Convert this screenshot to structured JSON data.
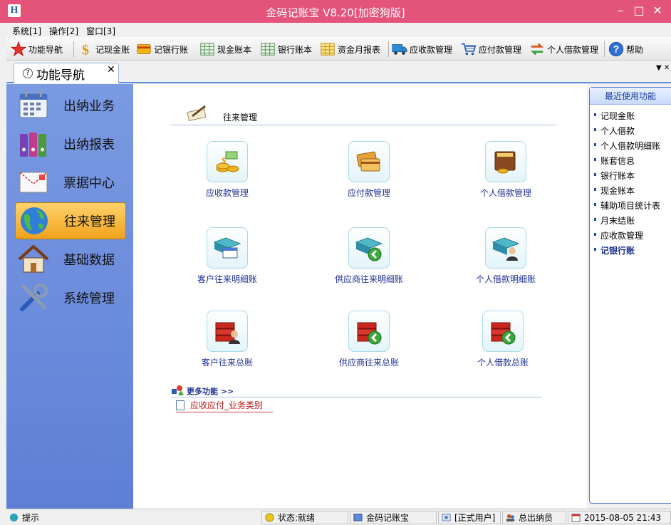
{
  "window": {
    "title": "金码记账宝 V8.20[加密狗版]",
    "min_glyph": "–",
    "max_glyph": "□",
    "close_glyph": "✕",
    "icon_glyph": "H"
  },
  "menu": [
    "系统[1]",
    "操作[2]",
    "窗口[3]"
  ],
  "toolbar": [
    {
      "label": "功能导航",
      "icon": "star-icon"
    },
    {
      "label": "记现金账",
      "icon": "dollar-icon"
    },
    {
      "label": "记银行账",
      "icon": "card-icon"
    },
    {
      "label": "现金账本",
      "icon": "grid-icon"
    },
    {
      "label": "银行账本",
      "icon": "grid-icon"
    },
    {
      "label": "资金月报表",
      "icon": "grid-yellow-icon"
    },
    {
      "label": "应收款管理",
      "icon": "truck-icon"
    },
    {
      "label": "应付款管理",
      "icon": "cart-icon"
    },
    {
      "label": "个人借款管理",
      "icon": "exchange-icon"
    },
    {
      "label": "帮助",
      "icon": "help-icon"
    }
  ],
  "tab": {
    "label": "功能导航",
    "help_glyph": "?",
    "close_glyph": "✕",
    "arrows": "▼ ✕"
  },
  "nav": [
    {
      "label": "出纳业务",
      "icon": "calendar-icon",
      "active": false
    },
    {
      "label": "出纳报表",
      "icon": "binders-icon",
      "active": false
    },
    {
      "label": "票据中心",
      "icon": "envelope-icon",
      "active": false
    },
    {
      "label": "往来管理",
      "icon": "globe-icon",
      "active": true
    },
    {
      "label": "基础数据",
      "icon": "house-icon",
      "active": false
    },
    {
      "label": "系统管理",
      "icon": "tools-icon",
      "active": false
    }
  ],
  "section": {
    "title": "往来管理"
  },
  "functions": [
    {
      "label": "应收款管理",
      "icon": "coins-icon"
    },
    {
      "label": "应付款管理",
      "icon": "cards-icon"
    },
    {
      "label": "个人借款管理",
      "icon": "wallet-icon"
    },
    {
      "label": "客户往来明细账",
      "icon": "ledger-open-icon"
    },
    {
      "label": "供应商往来明细账",
      "icon": "ledger-back-icon"
    },
    {
      "label": "个人借款明细账",
      "icon": "ledger-user-icon"
    },
    {
      "label": "客户往来总账",
      "icon": "books-user-icon"
    },
    {
      "label": "供应商往来总账",
      "icon": "books-back-icon"
    },
    {
      "label": "个人借款总账",
      "icon": "books-back-icon"
    }
  ],
  "more": {
    "title": "更多功能 >>",
    "links": [
      "应收应付_业务类别"
    ]
  },
  "recent": {
    "title": "最近使用功能",
    "items": [
      {
        "label": "记现金账",
        "bold": false
      },
      {
        "label": "个人借款",
        "bold": false
      },
      {
        "label": "个人借款明细账",
        "bold": false
      },
      {
        "label": "账套信息",
        "bold": false
      },
      {
        "label": "银行账本",
        "bold": false
      },
      {
        "label": "现金账本",
        "bold": false
      },
      {
        "label": "辅助项目统计表",
        "bold": false
      },
      {
        "label": "月末结账",
        "bold": false
      },
      {
        "label": "应收款管理",
        "bold": false
      },
      {
        "label": "记银行账",
        "bold": true
      }
    ]
  },
  "status": {
    "hint": "提示",
    "state": "状态:就绪",
    "app": "金码记账宝",
    "user_type": "[正式用户]",
    "user": "总出纳员",
    "datetime": "2015-08-05 21:43"
  }
}
